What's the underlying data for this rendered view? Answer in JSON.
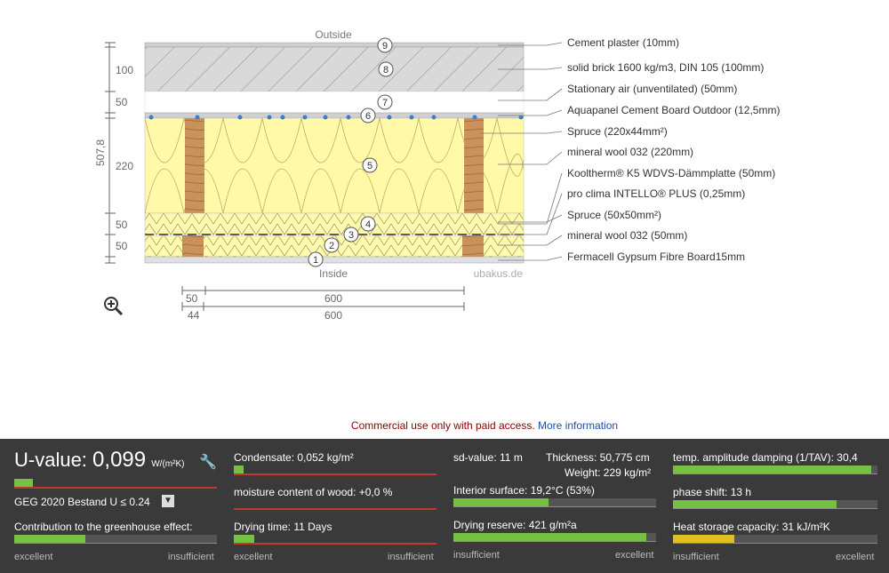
{
  "diagram": {
    "top_label": "Outside",
    "bottom_label": "Inside",
    "watermark": "ubakus.de",
    "total_thickness": "507,8",
    "left_dims": [
      "100",
      "50",
      "220",
      "50",
      "50"
    ],
    "bottom_dims": {
      "row1": [
        "50",
        "600"
      ],
      "row2": [
        "44",
        "600"
      ]
    },
    "layers": [
      {
        "num": "9",
        "label": "Cement plaster (10mm)"
      },
      {
        "num": "8",
        "label": "solid brick 1600 kg/m3, DIN 105 (100mm)"
      },
      {
        "num": "7",
        "label": "Stationary air (unventilated) (50mm)"
      },
      {
        "num": "6",
        "label": "Aquapanel Cement Board Outdoor (12,5mm)"
      },
      {
        "num": "",
        "label": "Spruce (220x44mm²)"
      },
      {
        "num": "5",
        "label": "mineral wool 032 (220mm)"
      },
      {
        "num": "",
        "label": "Kooltherm® K5 WDVS-Dämmplatte (50mm)"
      },
      {
        "num": "",
        "label": "pro clima INTELLO® PLUS (0,25mm)"
      },
      {
        "num": "4",
        "label": "Spruce (50x50mm²)"
      },
      {
        "num": "3",
        "label": "mineral wool 032 (50mm)"
      },
      {
        "num": "2",
        "label": "Fermacell Gypsum Fibre Board15mm"
      },
      {
        "num": "1",
        "label": ""
      }
    ],
    "zoom_icon": "zoom-in-icon"
  },
  "notice": {
    "text": "Commercial use only with paid access.",
    "link": "More information"
  },
  "panel": {
    "uvalue": {
      "label": "U-value:",
      "value": "0,099",
      "unit": "W/(m²K)",
      "fill": 0.09
    },
    "standard": "GEG 2020 Bestand U ≤ 0.24",
    "greenhouse": {
      "label": "Contribution to the greenhouse effect:",
      "fill": 0.35
    },
    "condensate": {
      "label": "Condensate: 0,052 kg/m²",
      "fill": 0.05
    },
    "moisture": {
      "label": "moisture content of wood: +0,0 %",
      "fill": 0.0
    },
    "drying_time": {
      "label": "Drying time: 11 Days",
      "fill": 0.1
    },
    "sd": "sd-value: 11 m",
    "thickness": "Thickness: 50,775 cm",
    "weight": "Weight: 229 kg/m²",
    "interior": {
      "label": "Interior surface: 19,2°C (53%)",
      "fill": 0.47
    },
    "drying_reserve": {
      "label": "Drying reserve: 421 g/m²a",
      "fill": 0.95
    },
    "damping": {
      "label": "temp. amplitude damping (1/TAV): 30,4",
      "fill": 0.97
    },
    "phase": {
      "label": "phase shift: 13 h",
      "fill": 0.8
    },
    "heat": {
      "label": "Heat storage capacity: 31 kJ/m²K",
      "fill": 0.3
    },
    "scale_excellent": "excellent",
    "scale_insufficient": "insufficient"
  }
}
